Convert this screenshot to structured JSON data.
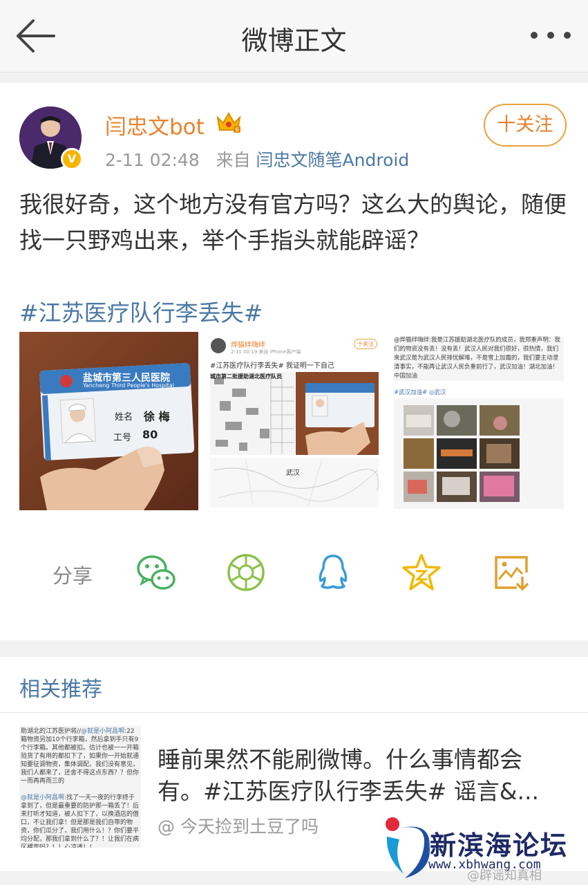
{
  "header": {
    "title": "微博正文"
  },
  "post": {
    "username": "闫忠文bot",
    "time": "2-11 02:48",
    "from_label": "来自",
    "source": "闫忠文随笔Android",
    "follow_label": "十关注",
    "text": "我很好奇，这个地方没有官方吗？这么大的舆论，随便找一只野鸡出来，举个手指头就能辟谣？",
    "hashtag": "#江苏医疗队行李丢失#",
    "images": {
      "badge_hospital": "盐城市第三人民医院",
      "badge_hospital_en": "Yancheng Third People's Hospital",
      "badge_name_label": "姓名",
      "badge_name": "徐 梅",
      "badge_id_label": "工号",
      "badge_id": "80",
      "img2_user": "烨猫绊嗨绊",
      "img2_time": "2-11 00:19  来自 iPhone客户端",
      "img2_follow": "十关注",
      "img2_text": "#江苏医疗队行李丢失# 我证明一下自己",
      "img2_doc_title": "城市第二批援助湖北医疗队员",
      "img2_map_label": "武汉",
      "img3_text": "@烨猫绊嗨绊:我是江苏援助湖北医疗队的成员，我郑重声明：我们的物资没有丢！没有丢！武汉人民对我们很好，很热情，我们来武汉是为武汉人民排忧解难，不是雪上加霜的，我们要主动澄清事实，不能再让武汉人民负重前行了，武汉加油！湖北加油！中国加油",
      "img3_tags": "#武汉加油# ◎武汉"
    }
  },
  "share": {
    "label": "分享"
  },
  "recommend": {
    "title": "相关推荐",
    "thumb_text_1": "助湖北的江苏医护将//",
    "thumb_mention_1": "@就是小阿昌啊:",
    "thumb_text_2": "22箱物资另加10个行李箱，然后拿到手只有9个行李箱。其他都被扣。估计也被一一开箱验货了有用的都扣下了，如果你一开始就通知要征调物资，集体调配，我们没有意见，我们人都来了，还舍不得这点东西？？但你一而再再而三的",
    "thumb_mention_2": "@就是小阿昌啊:",
    "thumb_text_3": "找了一天一夜的行李终于拿到了，但是最重要的防护那一箱丢了！后来打听才知道，被人扣下了，以换酒店的借口，不让我们拿！但是那是我们自带的物资，你们瓜分了，我们用什么！？你们要平均分配，那我们拿到什么了？！让我们在病区裸奔吗？！！心凉透！！",
    "item_text": "睡前果然不能刷微博。什么事情都会有。#江苏医疗队行李丢失# 谣言&...",
    "item_author": "@ 今天捡到土豆了吗"
  },
  "watermark": {
    "site": "新滨海论坛",
    "url": "www.xbhwang.com",
    "weibo": "@辟谣知真相"
  },
  "colors": {
    "link": "#4a78a6",
    "username": "#e8812c",
    "accent": "#f7b500"
  }
}
